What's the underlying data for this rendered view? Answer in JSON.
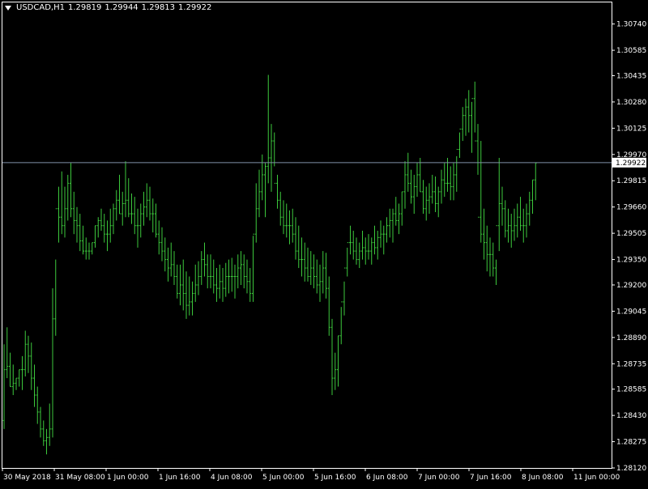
{
  "header": {
    "symbol": "USDCAD,H1",
    "open": "1.29819",
    "high": "1.29944",
    "low": "1.29813",
    "close": "1.29922"
  },
  "colors": {
    "background": "#000000",
    "bars": "#3cc83c",
    "axis": "#ffffff",
    "price_line": "#7f8fa8"
  },
  "chart_data": {
    "type": "ohlc",
    "title": "",
    "xlabel": "",
    "ylabel": "",
    "ylim": [
      1.2812,
      1.3081
    ],
    "grid": false,
    "current_price": 1.29922,
    "y_ticks": [
      "1.30740",
      "1.30585",
      "1.30435",
      "1.30280",
      "1.30125",
      "1.29970",
      "1.29815",
      "1.29660",
      "1.29505",
      "1.29350",
      "1.29200",
      "1.29045",
      "1.28890",
      "1.28735",
      "1.28585",
      "1.28430",
      "1.28275",
      "1.28120"
    ],
    "x_ticks": [
      "30 May 2018",
      "31 May 08:00",
      "1 Jun 00:00",
      "1 Jun 16:00",
      "4 Jun 08:00",
      "5 Jun 00:00",
      "5 Jun 16:00",
      "6 Jun 08:00",
      "7 Jun 00:00",
      "7 Jun 16:00",
      "8 Jun 08:00",
      "11 Jun 00:00"
    ],
    "high": [
      1.2885,
      1.2895,
      1.288,
      1.2873,
      1.2865,
      1.287,
      1.2878,
      1.2893,
      1.289,
      1.2886,
      1.2873,
      1.286,
      1.2848,
      1.284,
      1.2835,
      1.285,
      1.2918,
      1.2935,
      1.2978,
      1.2987,
      1.2978,
      1.2985,
      1.2992,
      1.2975,
      1.2966,
      1.2962,
      1.2955,
      1.2948,
      1.2945,
      1.2945,
      1.2955,
      1.296,
      1.2965,
      1.2962,
      1.2958,
      1.2965,
      1.2968,
      1.2976,
      1.2985,
      1.2975,
      1.2993,
      1.2983,
      1.2974,
      1.2972,
      1.2965,
      1.2968,
      1.2975,
      1.298,
      1.2978,
      1.2971,
      1.2968,
      1.2958,
      1.2954,
      1.2948,
      1.2942,
      1.2945,
      1.294,
      1.2932,
      1.2932,
      1.2935,
      1.2928,
      1.2925,
      1.2922,
      1.2932,
      1.2934,
      1.294,
      1.2945,
      1.2938,
      1.2938,
      1.2935,
      1.293,
      1.2932,
      1.293,
      1.2933,
      1.2935,
      1.2936,
      1.2932,
      1.2938,
      1.294,
      1.2938,
      1.2935,
      1.293,
      1.2949,
      1.298,
      1.2988,
      1.2997,
      1.2992,
      1.3044,
      1.3015,
      1.301,
      1.2985,
      1.2975,
      1.297,
      1.2968,
      1.2964,
      1.2965,
      1.296,
      1.2955,
      1.2948,
      1.2945,
      1.2942,
      1.294,
      1.2938,
      1.2935,
      1.2932,
      1.294,
      1.2939,
      1.2925,
      1.29,
      1.288,
      1.289,
      1.2907,
      1.2922,
      1.2942,
      1.2955,
      1.2952,
      1.2948,
      1.2945,
      1.2952,
      1.2948,
      1.295,
      1.2948,
      1.2955,
      1.2952,
      1.2958,
      1.2955,
      1.296,
      1.2965,
      1.2965,
      1.2972,
      1.2968,
      1.2975,
      1.2993,
      1.2998,
      1.2988,
      1.2985,
      1.2992,
      1.2995,
      1.2982,
      1.2978,
      1.298,
      1.2985,
      1.2984,
      1.2978,
      1.2988,
      1.2992,
      1.2995,
      1.299,
      1.2992,
      1.2996,
      1.301,
      1.3025,
      1.303,
      1.3035,
      1.3028,
      1.304,
      1.3015,
      1.3005,
      1.2965,
      1.2955,
      1.2948,
      1.2945,
      1.2935,
      1.2995,
      1.2978,
      1.297,
      1.2965,
      1.2962,
      1.2965,
      1.2968,
      1.2972,
      1.2965,
      1.2968,
      1.2975,
      1.2982,
      1.2992
    ],
    "low": [
      1.2835,
      1.2865,
      1.286,
      1.2855,
      1.2858,
      1.286,
      1.2858,
      1.2866,
      1.2868,
      1.2858,
      1.2848,
      1.2838,
      1.283,
      1.2825,
      1.282,
      1.2825,
      1.283,
      1.289,
      1.2945,
      1.295,
      1.2948,
      1.2958,
      1.296,
      1.295,
      1.2945,
      1.294,
      1.2938,
      1.2935,
      1.2935,
      1.2938,
      1.2942,
      1.2948,
      1.2952,
      1.2945,
      1.294,
      1.2945,
      1.295,
      1.2958,
      1.2962,
      1.2955,
      1.296,
      1.296,
      1.2956,
      1.295,
      1.2942,
      1.2948,
      1.2955,
      1.296,
      1.2958,
      1.2951,
      1.2948,
      1.2938,
      1.2934,
      1.2928,
      1.2922,
      1.2925,
      1.292,
      1.2912,
      1.2908,
      1.2905,
      1.29,
      1.2902,
      1.2902,
      1.291,
      1.2914,
      1.292,
      1.2925,
      1.2918,
      1.2918,
      1.2915,
      1.291,
      1.2912,
      1.291,
      1.2913,
      1.2915,
      1.2916,
      1.2912,
      1.2918,
      1.292,
      1.2918,
      1.2915,
      1.291,
      1.291,
      1.2945,
      1.296,
      1.297,
      1.296,
      1.298,
      1.2975,
      1.299,
      1.2965,
      1.2955,
      1.295,
      1.2948,
      1.2944,
      1.2945,
      1.2935,
      1.293,
      1.2925,
      1.2922,
      1.2922,
      1.292,
      1.2918,
      1.2915,
      1.291,
      1.2915,
      1.2912,
      1.289,
      1.2855,
      1.2858,
      1.286,
      1.2885,
      1.2902,
      1.2925,
      1.2938,
      1.2935,
      1.2932,
      1.293,
      1.2935,
      1.2932,
      1.2935,
      1.2932,
      1.2938,
      1.2935,
      1.2942,
      1.2938,
      1.2945,
      1.2948,
      1.2945,
      1.2955,
      1.295,
      1.2955,
      1.2965,
      1.2975,
      1.2968,
      1.2962,
      1.2972,
      1.2975,
      1.2962,
      1.2958,
      1.2962,
      1.2968,
      1.2963,
      1.296,
      1.2968,
      1.2972,
      1.2975,
      1.297,
      1.297,
      1.2975,
      1.2995,
      1.3005,
      1.3008,
      1.301,
      1.2998,
      1.301,
      1.2985,
      1.2945,
      1.2935,
      1.2928,
      1.2925,
      1.2925,
      1.292,
      1.294,
      1.2955,
      1.2948,
      1.2945,
      1.2942,
      1.2946,
      1.2948,
      1.2952,
      1.2945,
      1.2948,
      1.2955,
      1.2962,
      1.297
    ],
    "open": [
      1.284,
      1.287,
      1.2872,
      1.286,
      1.2862,
      1.2865,
      1.287,
      1.287,
      1.2885,
      1.2878,
      1.2865,
      1.2855,
      1.2845,
      1.2835,
      1.2828,
      1.283,
      1.2835,
      1.29,
      1.2965,
      1.296,
      1.2955,
      1.2965,
      1.298,
      1.2965,
      1.2958,
      1.2955,
      1.2946,
      1.294,
      1.294,
      1.294,
      1.2945,
      1.2955,
      1.2958,
      1.2955,
      1.295,
      1.295,
      1.2955,
      1.2965,
      1.297,
      1.2962,
      1.2968,
      1.297,
      1.2962,
      1.2962,
      1.2955,
      1.2955,
      1.2962,
      1.2966,
      1.297,
      1.2962,
      1.2962,
      1.295,
      1.2945,
      1.294,
      1.2935,
      1.293,
      1.2932,
      1.2925,
      1.2915,
      1.292,
      1.2915,
      1.2908,
      1.291,
      1.2915,
      1.292,
      1.2925,
      1.2935,
      1.2932,
      1.2925,
      1.2925,
      1.292,
      1.2918,
      1.2922,
      1.2918,
      1.2925,
      1.2925,
      1.2925,
      1.2925,
      1.293,
      1.2932,
      1.2925,
      1.2922,
      1.2915,
      1.295,
      1.2965,
      1.2975,
      1.2985,
      1.299,
      1.2995,
      1.3005,
      1.298,
      1.297,
      1.296,
      1.2955,
      1.2955,
      1.2955,
      1.295,
      1.294,
      1.2935,
      1.2935,
      1.293,
      1.2925,
      1.293,
      1.2925,
      1.292,
      1.2922,
      1.293,
      1.2918,
      1.2895,
      1.2865,
      1.287,
      1.289,
      1.291,
      1.293,
      1.2945,
      1.2945,
      1.294,
      1.2935,
      1.294,
      1.2942,
      1.294,
      1.294,
      1.2945,
      1.2942,
      1.2948,
      1.295,
      1.295,
      1.2955,
      1.2958,
      1.2962,
      1.2958,
      1.2962,
      1.2975,
      1.2985,
      1.298,
      1.2972,
      1.2978,
      1.2985,
      1.2975,
      1.2965,
      1.297,
      1.2972,
      1.2975,
      1.2968,
      1.2975,
      1.2982,
      1.298,
      1.298,
      1.2978,
      1.2985,
      1.3,
      1.3012,
      1.302,
      1.3025,
      1.302,
      1.303,
      1.3005,
      1.296,
      1.295,
      1.2945,
      1.2938,
      1.2938,
      1.293,
      1.2955,
      1.2968,
      1.2965,
      1.2952,
      1.2955,
      1.2952,
      1.2955,
      1.296,
      1.2955,
      1.2955,
      1.2962,
      1.297,
      1.2982
    ],
    "close": [
      1.287,
      1.2872,
      1.286,
      1.2862,
      1.2865,
      1.287,
      1.287,
      1.2885,
      1.2878,
      1.2865,
      1.2855,
      1.2845,
      1.2835,
      1.2828,
      1.283,
      1.2835,
      1.29,
      1.2965,
      1.296,
      1.2955,
      1.2965,
      1.298,
      1.2965,
      1.2958,
      1.2955,
      1.2946,
      1.294,
      1.294,
      1.294,
      1.2945,
      1.2955,
      1.2958,
      1.2955,
      1.295,
      1.295,
      1.2955,
      1.2965,
      1.297,
      1.2962,
      1.2968,
      1.297,
      1.2962,
      1.2962,
      1.2955,
      1.2955,
      1.2962,
      1.2966,
      1.297,
      1.2962,
      1.2962,
      1.295,
      1.2945,
      1.294,
      1.2935,
      1.293,
      1.2932,
      1.2925,
      1.2915,
      1.292,
      1.2915,
      1.2908,
      1.291,
      1.2915,
      1.292,
      1.2925,
      1.2935,
      1.2932,
      1.2925,
      1.2925,
      1.292,
      1.2918,
      1.2922,
      1.2918,
      1.2925,
      1.2925,
      1.2925,
      1.2925,
      1.293,
      1.2932,
      1.2925,
      1.2922,
      1.2915,
      1.295,
      1.2965,
      1.2975,
      1.2985,
      1.299,
      1.2995,
      1.3005,
      1.298,
      1.297,
      1.296,
      1.2955,
      1.2955,
      1.2955,
      1.295,
      1.294,
      1.2935,
      1.2935,
      1.293,
      1.2925,
      1.293,
      1.2925,
      1.292,
      1.2922,
      1.293,
      1.2918,
      1.2895,
      1.2865,
      1.287,
      1.289,
      1.291,
      1.293,
      1.2945,
      1.2945,
      1.294,
      1.2935,
      1.294,
      1.2942,
      1.294,
      1.294,
      1.2945,
      1.2942,
      1.2948,
      1.295,
      1.295,
      1.2955,
      1.2958,
      1.2962,
      1.2958,
      1.2962,
      1.2975,
      1.2985,
      1.298,
      1.2972,
      1.2978,
      1.2985,
      1.2975,
      1.2965,
      1.297,
      1.2972,
      1.2975,
      1.2968,
      1.2975,
      1.2982,
      1.298,
      1.298,
      1.2978,
      1.2985,
      1.3,
      1.3012,
      1.302,
      1.3025,
      1.302,
      1.303,
      1.3005,
      1.296,
      1.295,
      1.2945,
      1.2938,
      1.2938,
      1.293,
      1.2955,
      1.2968,
      1.2965,
      1.2952,
      1.2955,
      1.2952,
      1.2955,
      1.296,
      1.2955,
      1.2955,
      1.2962,
      1.297,
      1.2982,
      1.2992
    ]
  }
}
